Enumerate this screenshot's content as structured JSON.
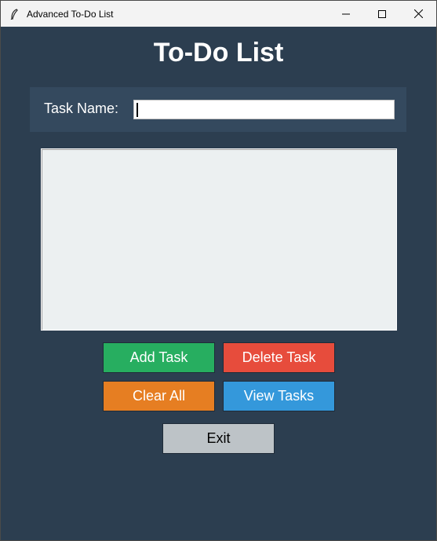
{
  "window": {
    "title": "Advanced To-Do List",
    "minimize_icon": "minimize-icon",
    "maximize_icon": "maximize-icon",
    "close_icon": "close-icon"
  },
  "app": {
    "heading": "To-Do List"
  },
  "entry": {
    "label": "Task Name:",
    "value": ""
  },
  "task_list": {
    "items": []
  },
  "buttons": {
    "add": "Add Task",
    "delete": "Delete Task",
    "clear": "Clear All",
    "view": "View Tasks",
    "exit": "Exit"
  },
  "colors": {
    "background": "#2c3e50",
    "entry_frame": "#34495e",
    "add": "#27ae60",
    "delete": "#e74c3c",
    "clear": "#e67e22",
    "view": "#3498db",
    "exit": "#bdc3c7",
    "listbox": "#ecf0f1"
  }
}
